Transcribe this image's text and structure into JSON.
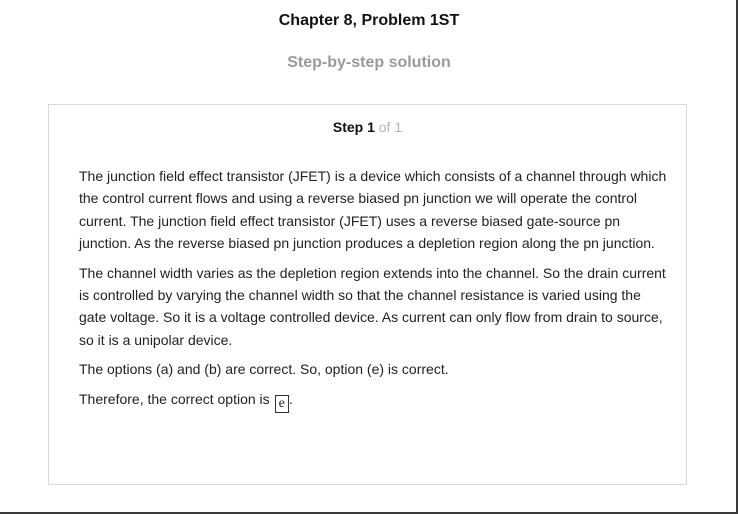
{
  "header": {
    "chapter_title": "Chapter 8, Problem 1ST",
    "subtitle": "Step-by-step solution"
  },
  "step": {
    "label": "Step 1",
    "count": "of 1"
  },
  "solution": {
    "paragraphs": [
      "The junction field effect transistor (JFET) is a device which consists of a channel through which the control current flows and using a reverse biased pn junction we will operate the control current. The junction field effect transistor (JFET) uses a reverse biased gate-source pn junction. As the reverse biased pn junction produces a depletion region along the pn junction.",
      "The channel width varies as the depletion region extends into the channel. So the drain current is controlled by varying the channel width so that the channel resistance is varied using the gate voltage. So it is a voltage controlled device. As current can only flow from drain to source, so it is a unipolar device.",
      "The options (a) and (b) are correct. So, option (e) is correct."
    ],
    "conclusion_text": "Therefore, the correct option is",
    "answer": "e",
    "conclusion_end": "."
  }
}
